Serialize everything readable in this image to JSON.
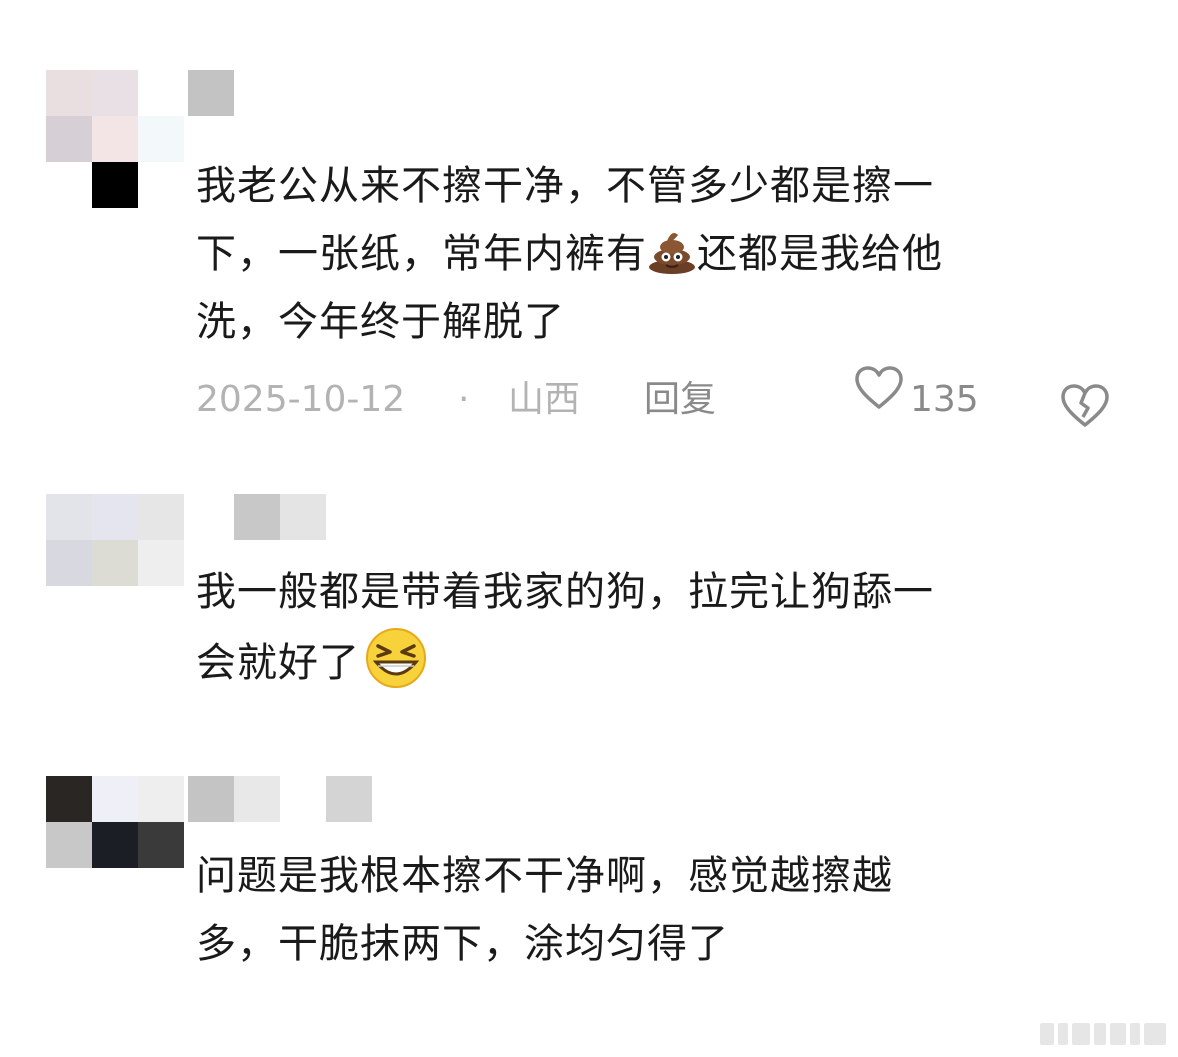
{
  "comments": [
    {
      "lines": [
        "我老公从来不擦干净，不管多少都是擦一",
        "下，一张纸，常年内裤有",
        "还都是我给他",
        "洗，今年终于解脱了"
      ],
      "inline_emoji": "poop-emoji",
      "date": "2025-10-12",
      "separator": "·",
      "location": "山西",
      "reply_label": "回复",
      "like_count": "135"
    },
    {
      "lines": [
        "我一般都是带着我家的狗，拉完让狗舔一",
        "会就好了"
      ],
      "inline_emoji": "grinning-squint-emoji"
    },
    {
      "lines": [
        "问题是我根本擦不干净啊，感觉越擦越",
        "多，干脆抹两下，涂均匀得了"
      ]
    }
  ],
  "icons": {
    "like": "heart-outline-icon",
    "dislike": "broken-heart-icon"
  },
  "colors": {
    "text": "#1a1a1a",
    "meta": "#b3b3b3",
    "action": "#8a8a8a"
  }
}
